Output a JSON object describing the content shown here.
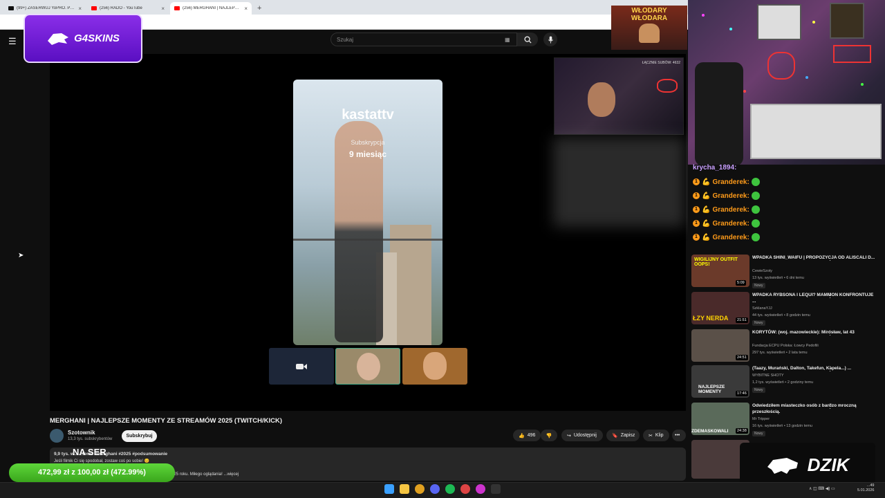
{
  "browser": {
    "tabs": [
      {
        "label": "(99+) ZASERWUJ YoPRO. PEŁNI",
        "active": false,
        "favicon_color": "#111111"
      },
      {
        "label": "(256) RADO - YouTube",
        "active": false,
        "favicon_color": "#ff0000"
      },
      {
        "label": "(256) MERGHANI | NAJLEPSZE",
        "active": true,
        "favicon_color": "#ff0000"
      }
    ],
    "new_tab_symbol": "+",
    "close_symbol": "×"
  },
  "youtube": {
    "menu_icon": "☰",
    "search_placeholder": "Szukaj",
    "video_title": "MERGHANI | NAJLEPSZE MOMENTY ZE STREAMÓW 2025 (TWITCH/KICK)",
    "channel_name": "Szotownik",
    "channel_subs": "13,3 tys. subskrybentów",
    "subscribe_label": "Subskrybuj",
    "likes": "496",
    "share_label": "Udostępnij",
    "save_label": "Zapisz",
    "clip_label": "Klip",
    "more_label": "•••",
    "desc_line1": "9,9 tys. w... ...temu  #merghani #2025 #podsumowanie",
    "desc_line2": "Jeśli filmik Ci się spodobał, zostaw coś po sobie! 😊",
    "desc_line3": "...owanie najlepszych momentów ze streamów Merghaniego z 2025 roku. Miłego oglądania! ...więcej"
  },
  "video_overlay": {
    "username": "kastattv",
    "sub_label": "Subskrypcja",
    "months": "9 miesiąc",
    "cam_counter": "ŁĄCZNIE SUBÓW: 4632"
  },
  "stream_overlay": {
    "logo_text": "G4SKINS",
    "banner_text": "WŁODARY WŁODARA",
    "naser": "NA SER",
    "donation": "472,99 zł z 100,00 zł (472.99%)",
    "dzik_text": "DZIK"
  },
  "chat": [
    {
      "user": "krycha_1894:",
      "style": "plain"
    },
    {
      "user": "Granderek:",
      "style": "badge"
    },
    {
      "user": "Granderek:",
      "style": "badge"
    },
    {
      "user": "Granderek:",
      "style": "badge"
    },
    {
      "user": "Granderek:",
      "style": "badge"
    },
    {
      "user": "Granderek:",
      "style": "badge"
    }
  ],
  "sidebar_videos": [
    {
      "title": "WPADKA SHINI_WAIFU | PROPOZYCJA OD ALISCALI D...",
      "channel": "CewieSzoty",
      "meta": "13 tys. wyświetleń • 6 dni temu",
      "badge": "Nowy",
      "duration": "5:09",
      "thumb_color": "#6b3a2a",
      "thumb_text": "WIGILIJNY OUTFIT  OOPS!"
    },
    {
      "title": "WPADKA RYBSONA I LEQUI? MAMMON KONFRONTUJE ...",
      "channel": "SzklanaYJJ",
      "meta": "44 tys. wyświetleń • 8 godzin temu",
      "badge": "Nowy",
      "duration": "21:51",
      "thumb_color": "#4a2a2a",
      "thumb_text": "ŁZY NERDA"
    },
    {
      "title": "KORYTÓW: (woj. mazowieckie): Mirosław, lat 43",
      "channel": "Fundacja ECPU Polska: Łowcy Pedofili",
      "meta": "297 tys. wyświetleń • 2 lata temu",
      "badge": "",
      "duration": "24:51",
      "thumb_color": "#5a5048",
      "thumb_text": ""
    },
    {
      "title": "(Taazy, Murański, Dalton, Takefun, Kapela...) ...",
      "channel": "WYBITNE SHOTY",
      "meta": "1,2 tys. wyświetleń • 2 godziny temu",
      "badge": "Nowy",
      "duration": "17:46",
      "thumb_color": "#3a3a3a",
      "thumb_text": "NAJLEPSZE MOMENTY"
    },
    {
      "title": "Odwiedziłem miasteczko osób z bardzo mroczną przeszłością.",
      "channel": "Mr Tripper",
      "meta": "16 tys. wyświetleń • 13 godzin temu",
      "badge": "Nowy",
      "duration": "24:38",
      "thumb_color": "#5a6a5a",
      "thumb_text": "ZDEMASKOWALI"
    },
    {
      "title": "",
      "channel": "",
      "meta": "",
      "badge": "",
      "duration": "",
      "thumb_color": "#4a3a3a",
      "thumb_text": ""
    }
  ],
  "taskbar": {
    "time": "...49",
    "date": "5.01.2026",
    "tray": "∧  ◫  ⌨  ◀)  ▭"
  },
  "colors": {
    "accent_red": "#ff0000",
    "donate_green": "#4cc12a",
    "chat_orange": "#ff9b1a",
    "logo_purple": "#7a22d8"
  }
}
